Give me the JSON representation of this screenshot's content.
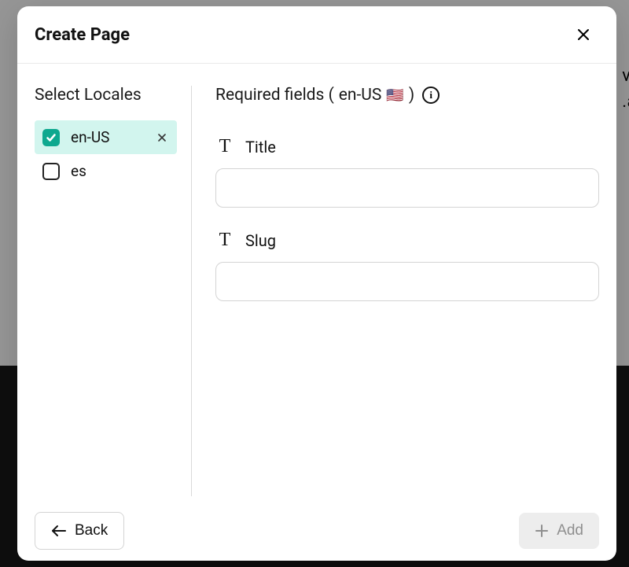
{
  "modal": {
    "title": "Create Page",
    "locales": {
      "heading": "Select Locales",
      "items": [
        {
          "label": "en-US",
          "checked": true
        },
        {
          "label": "es",
          "checked": false
        }
      ]
    },
    "required": {
      "heading_prefix": "Required fields (",
      "heading_locale": "en-US",
      "heading_flag": "🇺🇸",
      "heading_suffix": ")",
      "fields": [
        {
          "label": "Title",
          "value": ""
        },
        {
          "label": "Slug",
          "value": ""
        }
      ]
    },
    "footer": {
      "back_label": "Back",
      "add_label": "Add"
    }
  }
}
